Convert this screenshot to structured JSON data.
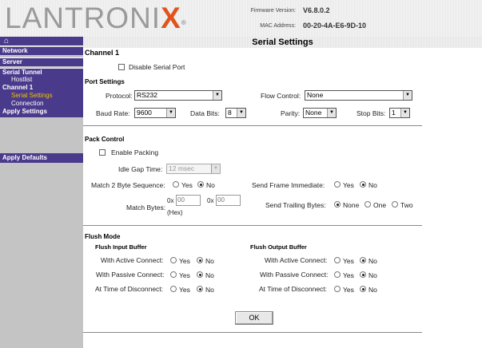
{
  "header": {
    "logo_text": "LANTRONIX",
    "firmware_label": "Firmware Version:",
    "firmware_value": "V6.8.0.2",
    "mac_label": "MAC Address:",
    "mac_value": "00-20-4A-E6-9D-10"
  },
  "sidebar": {
    "items": [
      {
        "label": "Network"
      },
      {
        "label": "Server"
      },
      {
        "label": "Serial Tunnel"
      },
      {
        "label": "Hostlist"
      },
      {
        "label": "Channel 1"
      },
      {
        "label": "Serial Settings"
      },
      {
        "label": "Connection"
      },
      {
        "label": "Apply Settings"
      },
      {
        "label": "Apply Defaults"
      }
    ]
  },
  "page": {
    "title": "Serial Settings",
    "channel": "Channel 1",
    "disable_serial_port": "Disable Serial Port",
    "port_settings": {
      "heading": "Port Settings",
      "protocol_label": "Protocol:",
      "protocol_value": "RS232",
      "flow_control_label": "Flow Control:",
      "flow_control_value": "None",
      "baud_rate_label": "Baud Rate:",
      "baud_rate_value": "9600",
      "data_bits_label": "Data Bits:",
      "data_bits_value": "8",
      "parity_label": "Parity:",
      "parity_value": "None",
      "stop_bits_label": "Stop Bits:",
      "stop_bits_value": "1"
    },
    "pack_control": {
      "heading": "Pack Control",
      "enable_packing": "Enable Packing",
      "idle_gap_label": "Idle Gap Time:",
      "idle_gap_value": "12 msec",
      "match2_label": "Match 2 Byte Sequence:",
      "send_frame_label": "Send Frame Immediate:",
      "match_bytes_label": "Match Bytes:",
      "hex_prefix": "0x",
      "match_byte_1": "00",
      "match_byte_2": "00",
      "hex_note": "(Hex)",
      "send_trailing_label": "Send Trailing Bytes:",
      "yes": "Yes",
      "no": "No",
      "none": "None",
      "one": "One",
      "two": "Two"
    },
    "flush_mode": {
      "heading": "Flush Mode",
      "input_heading": "Flush Input Buffer",
      "output_heading": "Flush Output Buffer",
      "active_label": "With Active Connect:",
      "passive_label": "With Passive Connect:",
      "disconnect_label": "At Time of Disconnect:",
      "yes": "Yes",
      "no": "No"
    },
    "ok_label": "OK"
  }
}
